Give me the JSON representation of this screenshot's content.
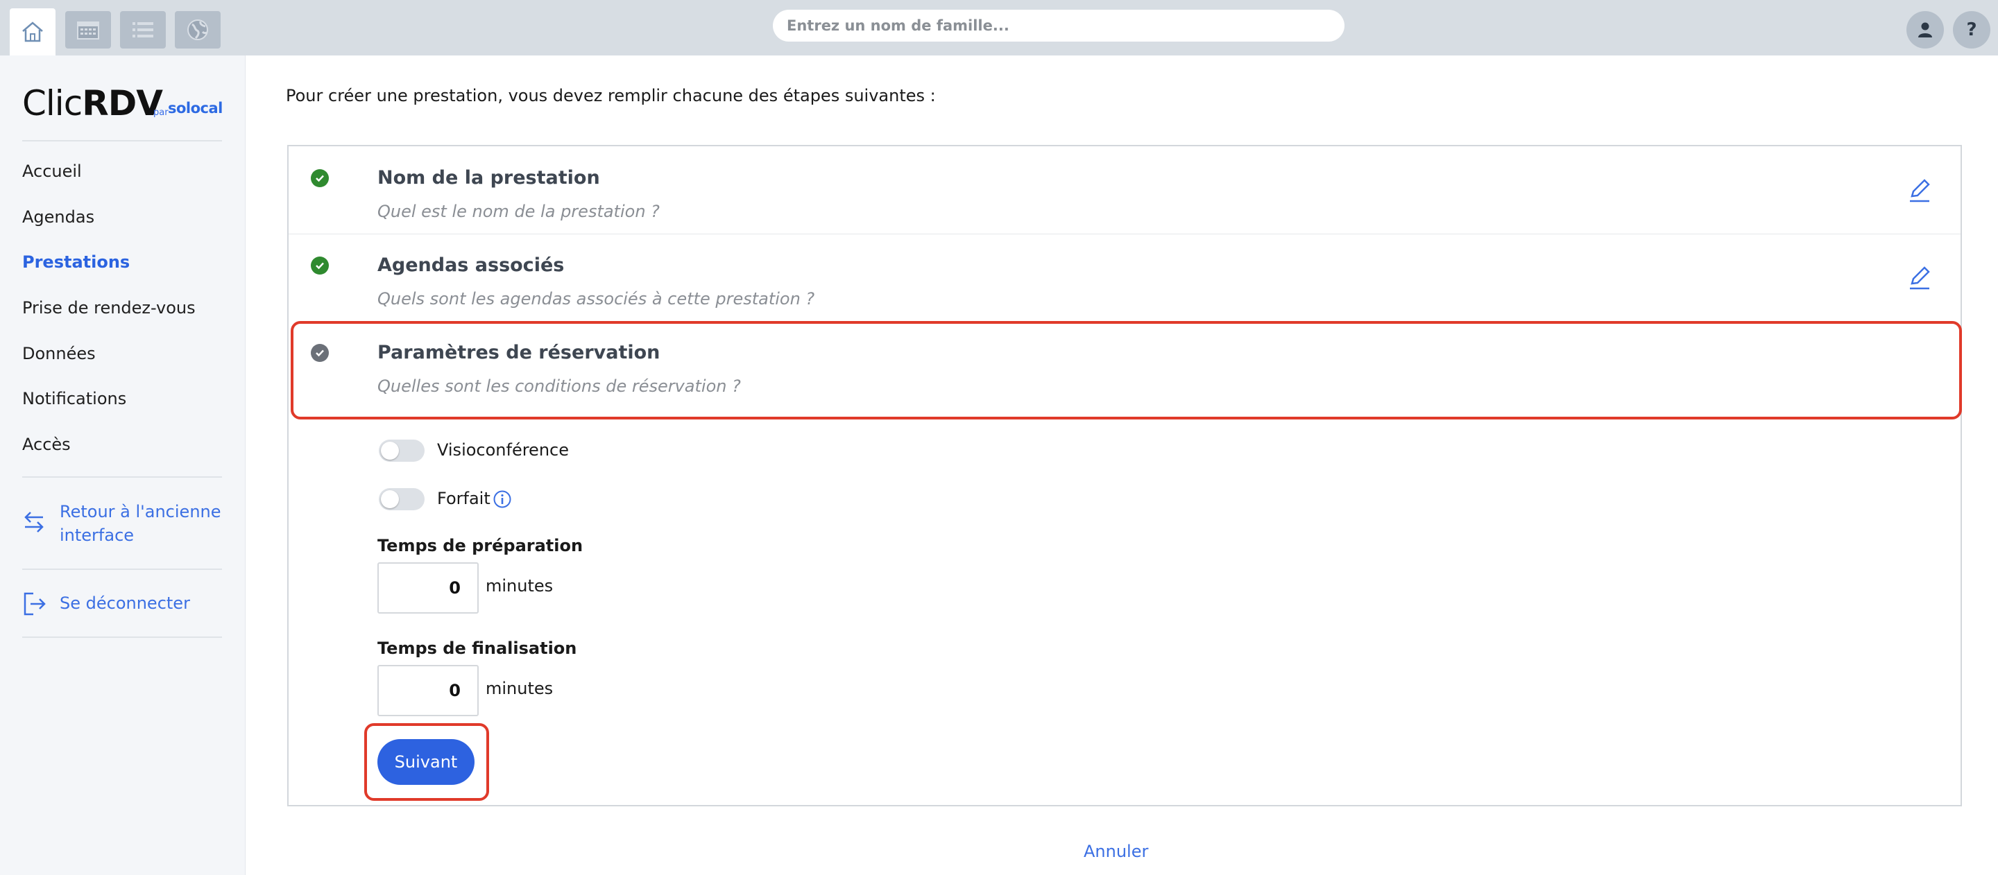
{
  "topbar": {
    "search_placeholder": "Entrez un nom de famille..."
  },
  "sidebar": {
    "logo_clic": "Clic",
    "logo_rdv": "RDV",
    "logo_par": "par",
    "logo_solocal": "solocal",
    "items": [
      {
        "label": "Accueil"
      },
      {
        "label": "Agendas"
      },
      {
        "label": "Prestations"
      },
      {
        "label": "Prise de rendez-vous"
      },
      {
        "label": "Données"
      },
      {
        "label": "Notifications"
      },
      {
        "label": "Accès"
      }
    ],
    "back_line1": "Retour à l'ancienne",
    "back_line2": "interface",
    "logout": "Se déconnecter"
  },
  "main": {
    "intro": "Pour créer une prestation, vous devez remplir chacune des étapes suivantes :",
    "steps": [
      {
        "title": "Nom de la prestation",
        "subtitle": "Quel est le nom de la prestation ?"
      },
      {
        "title": "Agendas associés",
        "subtitle": "Quels sont les agendas associés à cette prestation ?"
      },
      {
        "title": "Paramètres de réservation",
        "subtitle": "Quelles sont les conditions de réservation ?"
      }
    ],
    "toggles": {
      "visio": "Visioconférence",
      "forfait": "Forfait"
    },
    "prep_label": "Temps de préparation",
    "prep_value": "0",
    "final_label": "Temps de finalisation",
    "final_value": "0",
    "unit": "minutes",
    "next_button": "Suivant",
    "cancel": "Annuler"
  },
  "colors": {
    "accent": "#2d62e0",
    "done_check": "#2f8a2f",
    "pending_check": "#6b7078",
    "highlight": "#e03a2a"
  }
}
